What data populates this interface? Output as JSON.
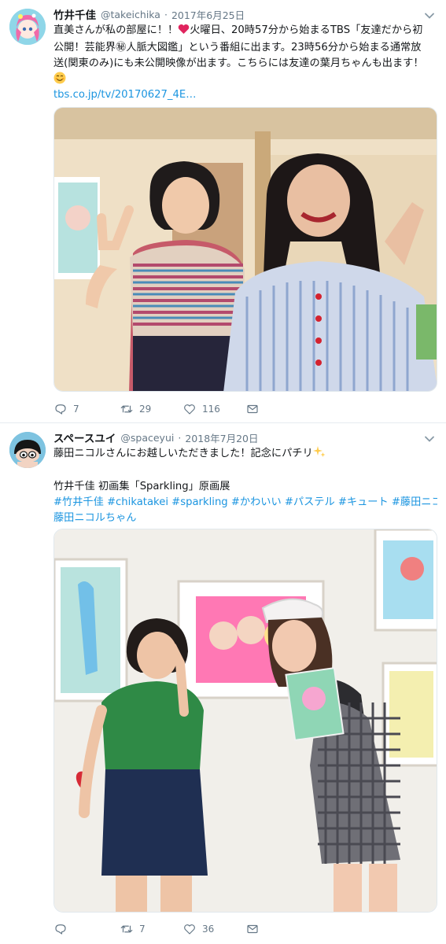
{
  "tweets": [
    {
      "display_name": "竹井千佳",
      "handle": "@takeichika",
      "separator": "·",
      "date": "2017年6月25日",
      "text_lines": [
        "直美さんが私の部屋に！！",
        "火曜日、20時57分から始まるTBS「友達だから初",
        "公開！芸能界㊙人脈大図鑑」という番組に出ます。23時56分から始まる通常放",
        "送(関東のみ)にも未公開映像が出ます。こちらには友達の葉月ちゃんも出ます！",
        "tbs.co.jp/tv/20170627_4E…"
      ],
      "actions": {
        "reply": "7",
        "retweet": "29",
        "like": "116"
      }
    },
    {
      "display_name": "スペースユイ",
      "handle": "@spaceyui",
      "separator": "·",
      "date": "2018年7月20日",
      "text_lines": [
        "藤田ニコルさんにお越しいただきました！記念にパチリ",
        "竹井千佳 初画集「Sparkling」原画展"
      ],
      "hashtags_line1": "#竹井千佳 #chikatakei #sparkling #かわいい  #パステル #キュート #藤田ニコル #",
      "hashtags_line2": "藤田ニコルちゃん",
      "actions": {
        "reply": "",
        "retweet": "7",
        "like": "36"
      }
    }
  ],
  "icons": {
    "reply": "reply-icon",
    "retweet": "retweet-icon",
    "like": "heart-icon",
    "message": "envelope-icon",
    "caret": "chevron-down-icon"
  },
  "colors": {
    "link": "#1b95e0",
    "muted": "#657786",
    "heart_emoji": "#e0245e"
  }
}
